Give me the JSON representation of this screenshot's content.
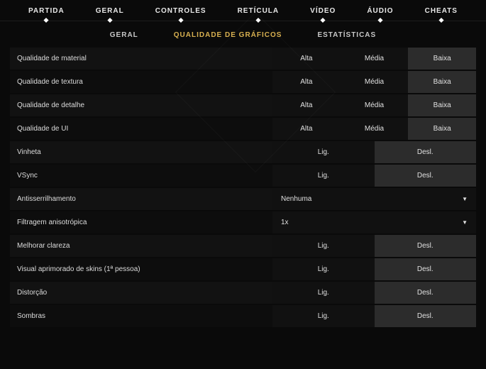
{
  "topnav": [
    {
      "id": "partida",
      "label": "PARTIDA"
    },
    {
      "id": "geral",
      "label": "GERAL"
    },
    {
      "id": "controles",
      "label": "CONTROLES"
    },
    {
      "id": "reticula",
      "label": "RETÍCULA"
    },
    {
      "id": "video",
      "label": "VÍDEO"
    },
    {
      "id": "audio",
      "label": "ÁUDIO"
    },
    {
      "id": "cheats",
      "label": "CHEATS"
    }
  ],
  "subnav": [
    {
      "id": "geral",
      "label": "GERAL",
      "active": false
    },
    {
      "id": "qualidade",
      "label": "QUALIDADE DE GRÁFICOS",
      "active": true
    },
    {
      "id": "estatisticas",
      "label": "ESTATÍSTICAS",
      "active": false
    }
  ],
  "opt_labels": {
    "alta": "Alta",
    "media": "Média",
    "baixa": "Baixa",
    "lig": "Lig.",
    "desl": "Desl."
  },
  "rows": [
    {
      "id": "material",
      "label": "Qualidade de material",
      "type": "tri",
      "selected": "baixa"
    },
    {
      "id": "textura",
      "label": "Qualidade de textura",
      "type": "tri",
      "selected": "baixa"
    },
    {
      "id": "detalhe",
      "label": "Qualidade de detalhe",
      "type": "tri",
      "selected": "baixa"
    },
    {
      "id": "ui",
      "label": "Qualidade de UI",
      "type": "tri",
      "selected": "baixa"
    },
    {
      "id": "vinheta",
      "label": "Vinheta",
      "type": "toggle",
      "selected": "desl"
    },
    {
      "id": "vsync",
      "label": "VSync",
      "type": "toggle",
      "selected": "desl"
    },
    {
      "id": "aa",
      "label": "Antisserrilhamento",
      "type": "dropdown",
      "value": "Nenhuma"
    },
    {
      "id": "aniso",
      "label": "Filtragem anisotrópica",
      "type": "dropdown",
      "value": "1x"
    },
    {
      "id": "clarity",
      "label": "Melhorar clareza",
      "type": "toggle",
      "selected": "desl"
    },
    {
      "id": "skins",
      "label": "Visual aprimorado de skins (1ª pessoa)",
      "type": "toggle",
      "selected": "desl"
    },
    {
      "id": "distortion",
      "label": "Distorção",
      "type": "toggle",
      "selected": "desl"
    },
    {
      "id": "shadows",
      "label": "Sombras",
      "type": "toggle",
      "selected": "desl"
    }
  ]
}
